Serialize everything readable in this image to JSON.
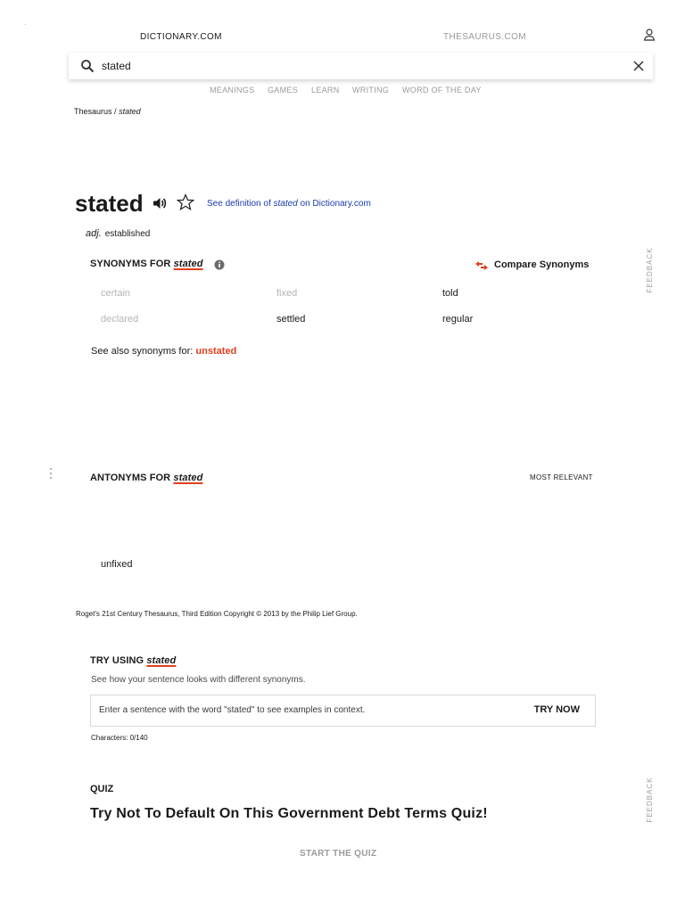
{
  "header": {
    "dictionary_link": "DICTIONARY.COM",
    "thesaurus_link": "THESAURUS.COM",
    "user_icon": "user-icon"
  },
  "search": {
    "value": "stated",
    "search_icon": "search-icon",
    "clear_icon": "close-icon"
  },
  "nav": {
    "items": [
      "MEANINGS",
      "GAMES",
      "LEARN",
      "WRITING",
      "WORD OF THE DAY"
    ]
  },
  "breadcrumb": {
    "root": "Thesaurus",
    "separator": "/",
    "current": "stated"
  },
  "entry": {
    "headword": "stated",
    "see_definition_prefix": "See definition of",
    "see_definition_word": "stated",
    "see_definition_suffix": "on Dictionary.com",
    "pos": "adj.",
    "sense": "established"
  },
  "synonyms": {
    "title_prefix": "SYNONYMS FOR",
    "title_word": "stated",
    "compare_label": "Compare Synonyms",
    "items": [
      {
        "word": "certain",
        "faded": true
      },
      {
        "word": "fixed",
        "faded": true
      },
      {
        "word": "told",
        "faded": false
      },
      {
        "word": "declared",
        "faded": true
      },
      {
        "word": "settled",
        "faded": false
      },
      {
        "word": "regular",
        "faded": false
      }
    ],
    "see_also_prefix": "See also synonyms for:",
    "see_also_word": "unstated"
  },
  "antonyms": {
    "title_prefix": "ANTONYMS FOR",
    "title_word": "stated",
    "sort_label": "MOST RELEVANT",
    "items": [
      "unfixed"
    ]
  },
  "copyright": "Roget's 21st Century Thesaurus, Third Edition Copyright © 2013 by the Philip Lief Group.",
  "try_using": {
    "title_prefix": "TRY USING",
    "title_word": "stated",
    "subtitle": "See how your sentence looks with different synonyms.",
    "placeholder": "Enter a sentence with the word \"stated\" to see examples in context.",
    "button": "TRY NOW",
    "char_count": "Characters: 0/140"
  },
  "quiz": {
    "label": "QUIZ",
    "title": "Try Not To Default On This Government Debt Terms Quiz!",
    "button": "START THE QUIZ"
  },
  "feedback_label": "FEEDBACK",
  "colors": {
    "accent": "#e0401f",
    "link_blue": "#1a3bb0",
    "muted": "#9a9a9a"
  }
}
